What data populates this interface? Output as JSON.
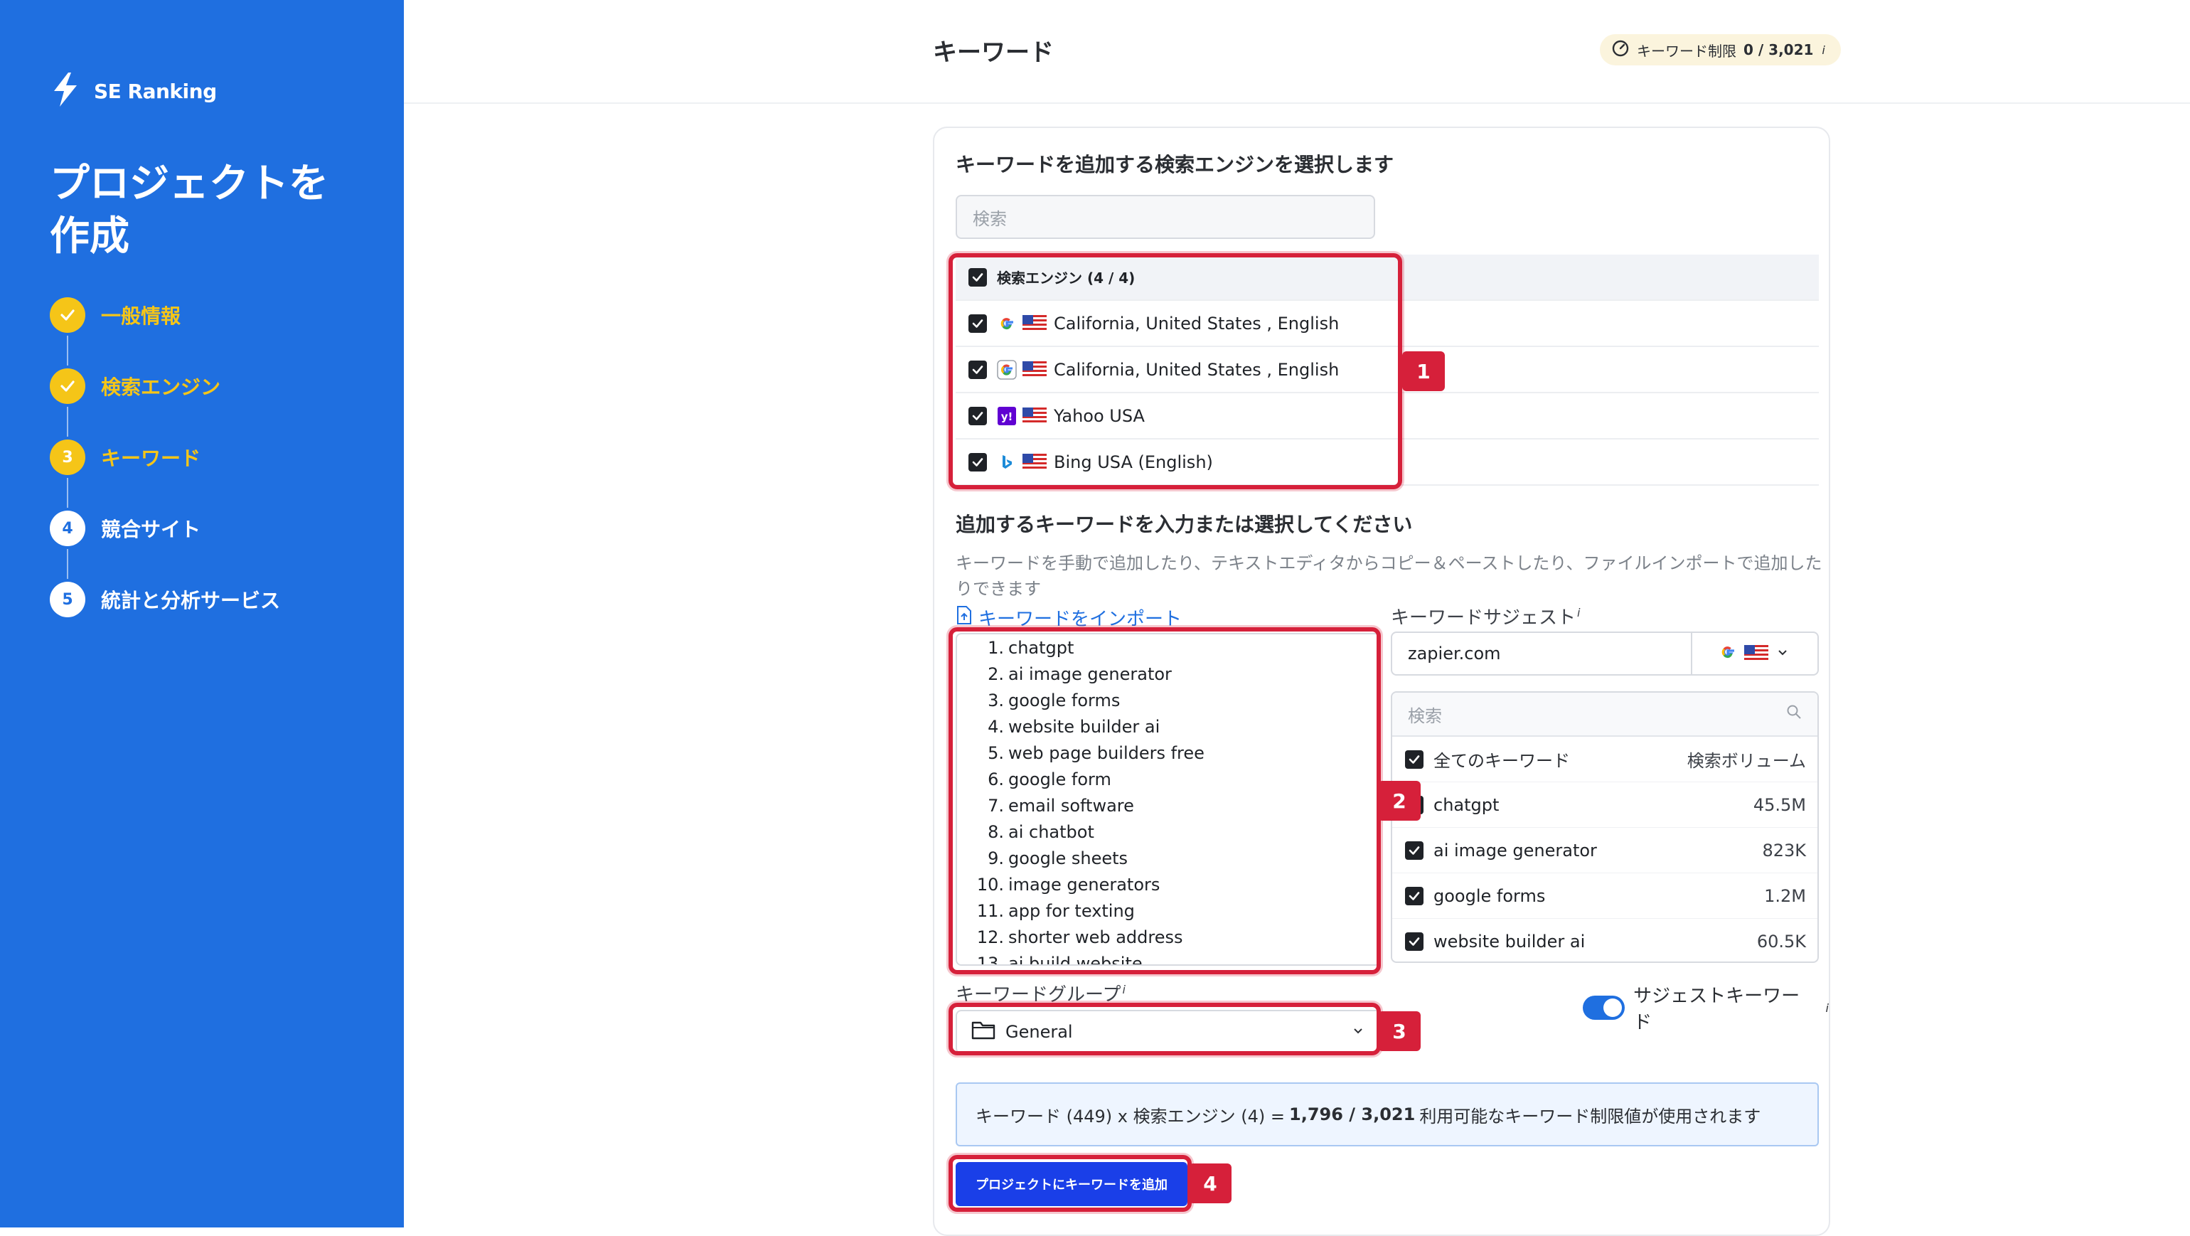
{
  "sidebar": {
    "brand": "SE Ranking",
    "title": "プロジェクトを作成",
    "steps": [
      {
        "num": "",
        "label": "一般情報",
        "state": "done"
      },
      {
        "num": "",
        "label": "検索エンジン",
        "state": "done"
      },
      {
        "num": "3",
        "label": "キーワード",
        "state": "active"
      },
      {
        "num": "4",
        "label": "競合サイト",
        "state": "todo"
      },
      {
        "num": "5",
        "label": "統計と分析サービス",
        "state": "todo"
      }
    ]
  },
  "header": {
    "title": "キーワード",
    "limit_label": "キーワード制限",
    "limit_value": "0 / 3,021",
    "info_mark": "i"
  },
  "engines": {
    "title": "キーワードを追加する検索エンジンを選択します",
    "search_placeholder": "検索",
    "header_label": "検索エンジン (4 / 4)",
    "items": [
      {
        "icon": "google-icon",
        "label": "California, United States , English"
      },
      {
        "icon": "google-mobile-icon",
        "label": "California, United States , English"
      },
      {
        "icon": "yahoo-icon",
        "label": "Yahoo USA"
      },
      {
        "icon": "bing-icon",
        "label": "Bing USA (English)"
      }
    ]
  },
  "keywords": {
    "title": "追加するキーワードを入力または選択してください",
    "subtitle": "キーワードを手動で追加したり、テキストエディタからコピー＆ペーストしたり、ファイルインポートで追加したりできます",
    "import_label": "キーワードをインポート",
    "list": [
      "chatgpt",
      "ai image generator",
      "google forms",
      "website builder ai",
      "web page builders free",
      "google form",
      "email software",
      "ai chatbot",
      "google sheets",
      "image generators",
      "app for texting",
      "shorter web address",
      "ai build website"
    ]
  },
  "suggest": {
    "label": "キーワードサジェスト",
    "domain": "zapier.com",
    "search_placeholder": "検索",
    "all_label": "全てのキーワード",
    "volume_header": "検索ボリューム",
    "rows": [
      {
        "name": "chatgpt",
        "volume": "45.5M"
      },
      {
        "name": "ai image generator",
        "volume": "823K"
      },
      {
        "name": "google forms",
        "volume": "1.2M"
      },
      {
        "name": "website builder ai",
        "volume": "60.5K"
      }
    ],
    "toggle_label": "サジェストキーワード",
    "toggle_on": true
  },
  "group": {
    "label": "キーワードグループ",
    "value": "General"
  },
  "summary": {
    "prefix": "キーワード (449) x 検索エンジン (4) =",
    "value": "1,796 / 3,021",
    "suffix": "利用可能なキーワード制限値が使用されます"
  },
  "submit_label": "プロジェクトにキーワードを追加",
  "markers": [
    "1",
    "2",
    "3",
    "4"
  ],
  "colors": {
    "sidebar": "#1f6fe0",
    "accent": "#f5c518",
    "highlight": "#d6203a",
    "button": "#1a3fe8"
  }
}
